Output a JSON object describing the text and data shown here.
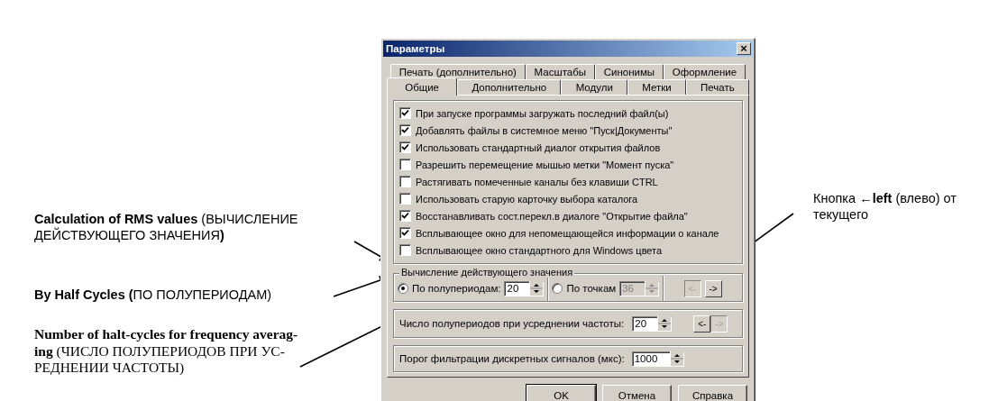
{
  "window": {
    "title": "Параметры",
    "close": "×"
  },
  "tab_rows": [
    [
      {
        "label": "Печать (дополнительно)",
        "selected": false
      },
      {
        "label": "Масштабы",
        "selected": false
      },
      {
        "label": "Синонимы",
        "selected": false
      },
      {
        "label": "Оформление",
        "selected": false
      }
    ],
    [
      {
        "label": "Общие",
        "selected": true
      },
      {
        "label": "Дополнительно",
        "selected": false
      },
      {
        "label": "Модули",
        "selected": false
      },
      {
        "label": "Метки",
        "selected": false
      },
      {
        "label": "Печать",
        "selected": false
      }
    ]
  ],
  "options": [
    {
      "label": "При запуске программы загружать последний файл(ы)",
      "checked": true
    },
    {
      "label": "Добавлять файлы в системное меню \"Пуск|Документы\"",
      "checked": true
    },
    {
      "label": "Использовать стандартный диалог открытия файлов",
      "checked": true
    },
    {
      "label": "Разрешить перемещение мышью метки \"Момент пуска\"",
      "checked": false
    },
    {
      "label": "Растягивать помеченные каналы без клавиши CTRL",
      "checked": false
    },
    {
      "label": "Использовать старую карточку выбора каталога",
      "checked": false
    },
    {
      "label": "Восстанавливать сост.перекл.в диалоге \"Открытие файла\"",
      "checked": true
    },
    {
      "label": "Всплывающее окно для непомещающейся информации о канале",
      "checked": true
    },
    {
      "label": "Всплывающее окно стандартного для Windows цвета",
      "checked": false
    }
  ],
  "rms_group": {
    "title": "Вычисление действующего значения",
    "radios": [
      {
        "label": "По полупериодам:",
        "selected": true,
        "value": "20",
        "disabled": false
      },
      {
        "label": "По точкам",
        "selected": false,
        "value": "36",
        "disabled": true
      }
    ],
    "nav": [
      {
        "label": "<-",
        "disabled": true
      },
      {
        "label": "->",
        "disabled": false
      }
    ]
  },
  "freq_row": {
    "label": "Число полупериодов при усреднении частоты:",
    "value": "20",
    "nav": [
      {
        "label": "<-",
        "disabled": false
      },
      {
        "label": "->",
        "disabled": true
      }
    ]
  },
  "filter_row": {
    "label": "Порог фильтрации дискретных сигналов (мкс):",
    "value": "1000"
  },
  "buttons": [
    {
      "label": "OK",
      "default": true
    },
    {
      "label": "Отмена",
      "default": false
    },
    {
      "label": "Справка",
      "default": false
    }
  ],
  "annotations": [
    {
      "text": "**Calculation of RMS values** (ВЫЧИСЛЕНИЕ ДЕЙСТВУЮЩЕГО ЗНАЧЕНИЯ**)**",
      "kind": "sans"
    },
    {
      "text": "**By Half Cycles (**ПО ПОЛУПЕРИОДАМ)",
      "kind": "sans"
    },
    {
      "text": "**Number of halt-cycles for frequency averag-ing** (ЧИСЛО ПОЛУПЕРИОДОВ ПРИ УС-РЕДНЕНИИ ЧАСТОТЫ)",
      "kind": "serif"
    },
    {
      "text": "Кнопка ←**left** (влево) от текущего",
      "kind": "sans"
    }
  ]
}
